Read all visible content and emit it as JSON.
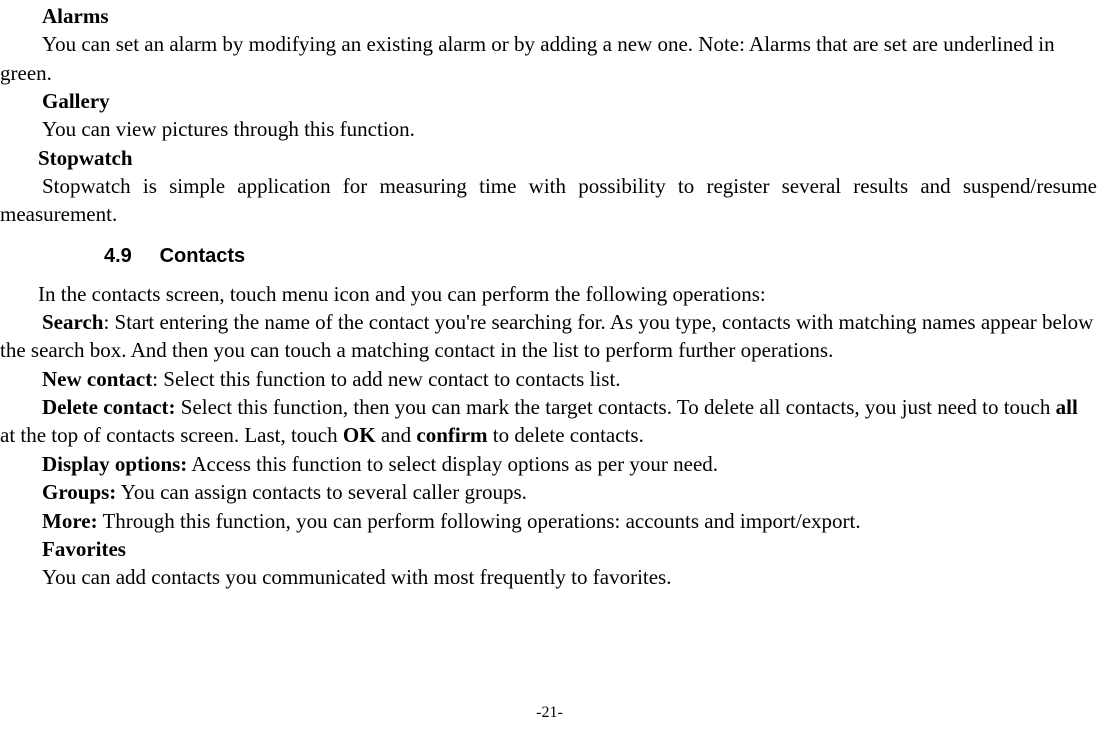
{
  "alarms": {
    "heading": "Alarms",
    "body": "You can set an alarm by modifying an existing alarm or by adding a new one. Note: Alarms that are set are underlined in green."
  },
  "gallery": {
    "heading": "Gallery",
    "body": "You can view pictures through this function."
  },
  "stopwatch": {
    "heading": "Stopwatch",
    "body": "Stopwatch is simple application for measuring time with possibility to register several results and suspend/resume measurement."
  },
  "section": {
    "number": "4.9",
    "title": "Contacts"
  },
  "contacts": {
    "intro": "In the contacts screen, touch menu icon and you can perform the following operations:",
    "search_label": "Search",
    "search_body": ": Start entering the name of the contact you're searching for. As you type, contacts with matching names appear below the search box. And then you can touch a matching contact in the list to perform further operations.",
    "newcontact_label": "New contact",
    "newcontact_body": ": Select this function to add new contact to contacts list.",
    "delete_label": "Delete contact:",
    "delete_body_1": " Select this function, then you can mark the target contacts. To delete all contacts, you just need to touch ",
    "delete_all": "all",
    "delete_body_2": " at the top of contacts screen. Last, touch ",
    "delete_ok": "OK",
    "delete_body_3": " and ",
    "delete_confirm": "confirm",
    "delete_body_4": " to delete contacts.",
    "display_label": "Display options:",
    "display_body": " Access this function to select display options as per your need.",
    "groups_label": "Groups:",
    "groups_body": " You can assign contacts to several caller groups.",
    "more_label": "More:",
    "more_body": " Through this function, you can perform following operations: accounts and import/export.",
    "favorites_heading": "Favorites",
    "favorites_body": "You can add contacts you communicated with most frequently to favorites."
  },
  "footer": {
    "page": "-21-"
  }
}
